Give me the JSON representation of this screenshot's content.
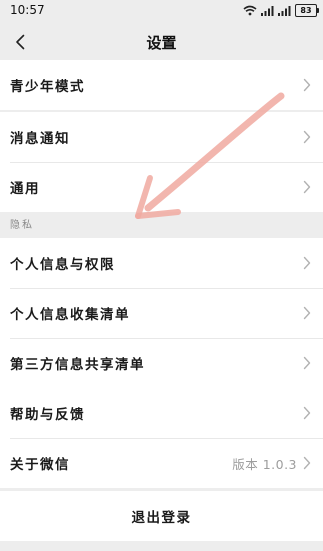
{
  "status_bar": {
    "time": "10:57",
    "battery": "83"
  },
  "nav": {
    "title": "设置"
  },
  "groups": {
    "g1": [
      "青少年模式"
    ],
    "g2": [
      "消息通知",
      "通用"
    ],
    "privacy_label": "隐私",
    "g3": [
      "个人信息与权限",
      "个人信息收集清单",
      "第三方信息共享清单"
    ],
    "g4": [
      "帮助与反馈",
      "关于微信"
    ],
    "about_version": "版本 1.0.3"
  },
  "logout": {
    "label": "退出登录"
  },
  "colors": {
    "background": "#ededed",
    "cell": "#ffffff",
    "annotation": "#f0a9a0"
  }
}
